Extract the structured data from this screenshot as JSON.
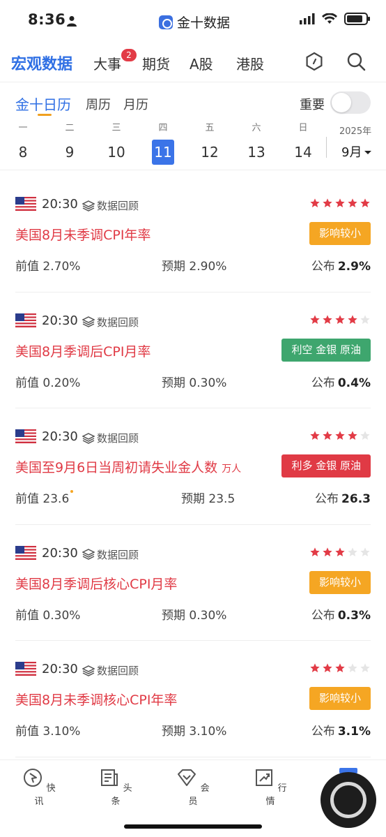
{
  "status_bar": {
    "time": "8:36",
    "app_name": "金十数据"
  },
  "top_nav": {
    "tabs": [
      {
        "label": "宏观数据",
        "active": true
      },
      {
        "label": "大事",
        "badge": "2"
      },
      {
        "label": "期货"
      },
      {
        "label": "A股"
      },
      {
        "label": "港股"
      }
    ],
    "icons": [
      "hexagon-icon",
      "search-icon"
    ]
  },
  "sub_tabs": {
    "tabs": [
      {
        "label": "金十日历",
        "active": true
      },
      {
        "label": "周历"
      },
      {
        "label": "月历"
      }
    ],
    "important_label": "重要",
    "important_on": false
  },
  "week": {
    "days": [
      {
        "weekday": "一",
        "date": "8"
      },
      {
        "weekday": "二",
        "date": "9"
      },
      {
        "weekday": "三",
        "date": "10"
      },
      {
        "weekday": "四",
        "date": "11",
        "selected": true
      },
      {
        "weekday": "五",
        "date": "12"
      },
      {
        "weekday": "六",
        "date": "13"
      },
      {
        "weekday": "日",
        "date": "14"
      }
    ],
    "year": "2025年",
    "month": "9月"
  },
  "events": [
    {
      "time": "20:30",
      "review": "数据回顾",
      "stars": 5,
      "title": "美国8月未季调CPI年率",
      "unit": "",
      "tag": "影响较小",
      "tag_color": "#f5a623",
      "prev_label": "前值",
      "prev": "2.70%",
      "forecast_label": "预期",
      "forecast": "2.90%",
      "actual_label": "公布",
      "actual": "2.9%",
      "prev_revised": false
    },
    {
      "time": "20:30",
      "review": "数据回顾",
      "stars": 4,
      "title": "美国8月季调后CPI月率",
      "unit": "",
      "tag": "利空 金银 原油",
      "tag_color": "#3ea66e",
      "prev_label": "前值",
      "prev": "0.20%",
      "forecast_label": "预期",
      "forecast": "0.30%",
      "actual_label": "公布",
      "actual": "0.4%",
      "prev_revised": false
    },
    {
      "time": "20:30",
      "review": "数据回顾",
      "stars": 4,
      "title": "美国至9月6日当周初请失业金人数",
      "unit": "万人",
      "tag": "利多 金银 原油",
      "tag_color": "#e03a45",
      "prev_label": "前值",
      "prev": "23.6",
      "forecast_label": "预期",
      "forecast": "23.5",
      "actual_label": "公布",
      "actual": "26.3",
      "prev_revised": true
    },
    {
      "time": "20:30",
      "review": "数据回顾",
      "stars": 3,
      "title": "美国8月季调后核心CPI月率",
      "unit": "",
      "tag": "影响较小",
      "tag_color": "#f5a623",
      "prev_label": "前值",
      "prev": "0.30%",
      "forecast_label": "预期",
      "forecast": "0.30%",
      "actual_label": "公布",
      "actual": "0.3%",
      "prev_revised": false
    },
    {
      "time": "20:30",
      "review": "数据回顾",
      "stars": 3,
      "title": "美国8月未季调核心CPI年率",
      "unit": "",
      "tag": "影响较小",
      "tag_color": "#f5a623",
      "prev_label": "前值",
      "prev": "3.10%",
      "forecast_label": "预期",
      "forecast": "3.10%",
      "actual_label": "公布",
      "actual": "3.1%",
      "prev_revised": false
    }
  ],
  "bottom_nav": [
    {
      "label": "快讯",
      "icon": "flash-news-icon"
    },
    {
      "label": "头条",
      "icon": "headline-icon"
    },
    {
      "label": "会员",
      "icon": "vip-diamond-icon"
    },
    {
      "label": "行情",
      "icon": "market-chart-icon"
    }
  ],
  "colors": {
    "accent": "#2f6fe4",
    "rise": "#e03a45",
    "star": "#e23b46",
    "yellow": "#f5a623",
    "green": "#3ea66e"
  }
}
